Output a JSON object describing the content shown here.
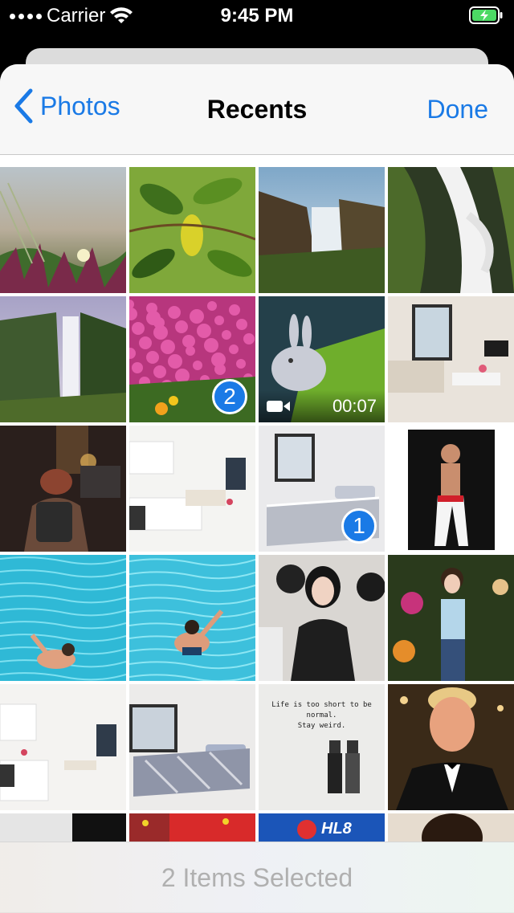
{
  "status": {
    "carrier": "Carrier",
    "time": "9:45 PM"
  },
  "nav": {
    "back_label": "Photos",
    "title": "Recents",
    "done_label": "Done"
  },
  "photos": [
    {
      "kind": "plant-dune"
    },
    {
      "kind": "leaves"
    },
    {
      "kind": "waterfall-canyon"
    },
    {
      "kind": "waterfall-stream"
    },
    {
      "kind": "waterfall-tall"
    },
    {
      "kind": "pink-flowers",
      "selection": "2"
    },
    {
      "kind": "animated-rabbit",
      "duration": "00:07"
    },
    {
      "kind": "living-room"
    },
    {
      "kind": "city-street"
    },
    {
      "kind": "kitchen"
    },
    {
      "kind": "bedroom",
      "selection": "1"
    },
    {
      "kind": "performer"
    },
    {
      "kind": "pool-swimmer-1"
    },
    {
      "kind": "pool-swimmer-2"
    },
    {
      "kind": "woman-crowd"
    },
    {
      "kind": "woman-flowers"
    },
    {
      "kind": "kitchen-2"
    },
    {
      "kind": "bedroom-2"
    },
    {
      "kind": "quote-card",
      "text_line1": "Life is too short to be normal.",
      "text_line2": "Stay weird."
    },
    {
      "kind": "man-speaking"
    },
    {
      "kind": "dark-partial"
    },
    {
      "kind": "flags-partial"
    },
    {
      "kind": "logo-partial",
      "logo_text": "HL8"
    },
    {
      "kind": "face-partial"
    }
  ],
  "bottom_bar": {
    "label": "2 Items Selected"
  }
}
